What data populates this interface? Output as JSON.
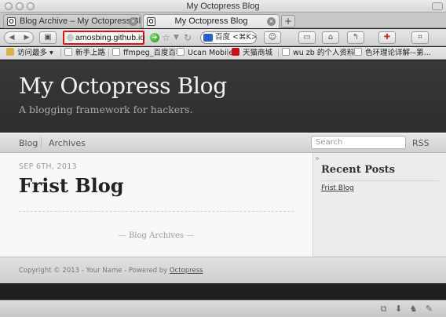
{
  "window": {
    "title": "My Octopress Blog"
  },
  "tabs": [
    {
      "label": "Blog Archive – My Octopress Blog",
      "favicon": "O",
      "active": false
    },
    {
      "label": "My Octopress Blog",
      "favicon": "O",
      "active": true
    }
  ],
  "newtab_symbol": "+",
  "navbar": {
    "url": "amosbing.github.io",
    "search_text": "百度 <⌘K>",
    "icons": [
      "back-arrow-icon",
      "forward-arrow-icon",
      "home-page-icon",
      "go-arrow-icon",
      "star-icon",
      "reload-icon"
    ]
  },
  "bookmarks": [
    {
      "label": "访问最多",
      "icon": "folder-icon"
    },
    {
      "label": "新手上路",
      "icon": "page-icon"
    },
    {
      "label": "ffmpeg_百度百科",
      "icon": "page-icon"
    },
    {
      "label": "Ucan Mobile",
      "icon": "page-icon"
    },
    {
      "label": "天猫商城",
      "icon": "tmall-icon"
    },
    {
      "label": "wu zb 的个人资料",
      "icon": "page-icon"
    },
    {
      "label": "色环理论详解-–第...",
      "icon": "page-icon"
    }
  ],
  "site": {
    "title": "My Octopress Blog",
    "subtitle": "A blogging framework for hackers.",
    "nav": [
      "Blog",
      "Archives"
    ],
    "search_placeholder": "Search",
    "rss": "RSS"
  },
  "post": {
    "date": "SEP 6TH, 2013",
    "title": "Frist Blog",
    "archives_link": "— Blog Archives —"
  },
  "sidebar": {
    "heading": "Recent Posts",
    "links": [
      "Frist Blog"
    ]
  },
  "footer": {
    "text": "Copyright © 2013 - Your Name - Powered by ",
    "link": "Octopress"
  },
  "colors": {
    "header_bg": "#333333",
    "url_highlight": "#e01010"
  }
}
